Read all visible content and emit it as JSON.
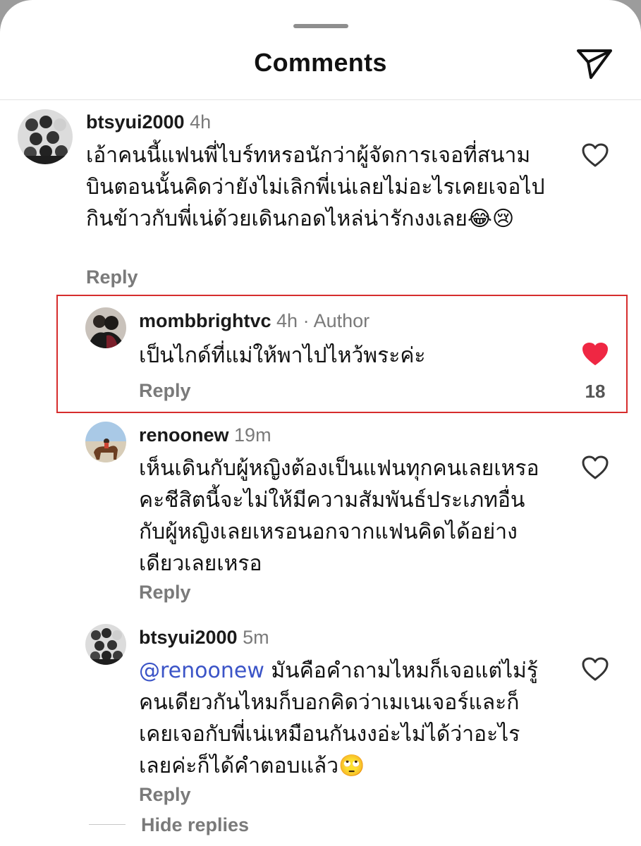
{
  "header": {
    "title": "Comments"
  },
  "comments": [
    {
      "username": "btsyui2000",
      "meta": "4h",
      "text": "เอ้าคนนี้แฟนพี่ไบร์ทหรอนักว่าผู้จัดการเจอที่สนามบินตอนนั้นคิดว่ายังไม่เลิกพี่เน่เลยไม่อะไรเคยเจอไปกินข้าวกับพี่เน่ด้วยเดินกอดไหล่น่ารักงงเลย😂😢",
      "reply_label": "Reply"
    },
    {
      "username": "mombbrightvc",
      "meta": "4h · Author",
      "text": "เป็นไกด์ที่แม่ให้พาไปไหว้พระค่ะ",
      "reply_label": "Reply",
      "likes": "18",
      "liked": true
    },
    {
      "username": "renoonew",
      "meta": "19m",
      "text": "เห็นเดินกับผู้หญิงต้องเป็นแฟนทุกคนเลยเหรอคะชีสิตนี้จะไม่ให้มีความสัมพันธ์ประเภทอื่นกับผู้หญิงเลยเหรอนอกจากแฟนคิดได้อย่างเดียวเลยเหรอ",
      "reply_label": "Reply"
    },
    {
      "username": "btsyui2000",
      "meta": "5m",
      "mention": "@renoonew",
      "text": " มันคือคำถามไหมก็เจอแต่ไม่รู้คนเดียวกันไหมก็บอกคิดว่าเมเนเจอร์และก็เคยเจอกับพี่เน่เหมือนกันงงอ่ะไม่ได้ว่าอะไรเลยค่ะก็ได้คำตอบแล้ว🙄",
      "reply_label": "Reply"
    }
  ],
  "hide_replies_label": "Hide replies",
  "icons": {
    "send": "send-icon",
    "heart_outline": "heart-outline-icon",
    "heart_filled": "heart-filled-icon"
  },
  "colors": {
    "like_red": "#ef2743",
    "mention_blue": "#3b54c7",
    "highlight_border": "#d62d2d"
  }
}
